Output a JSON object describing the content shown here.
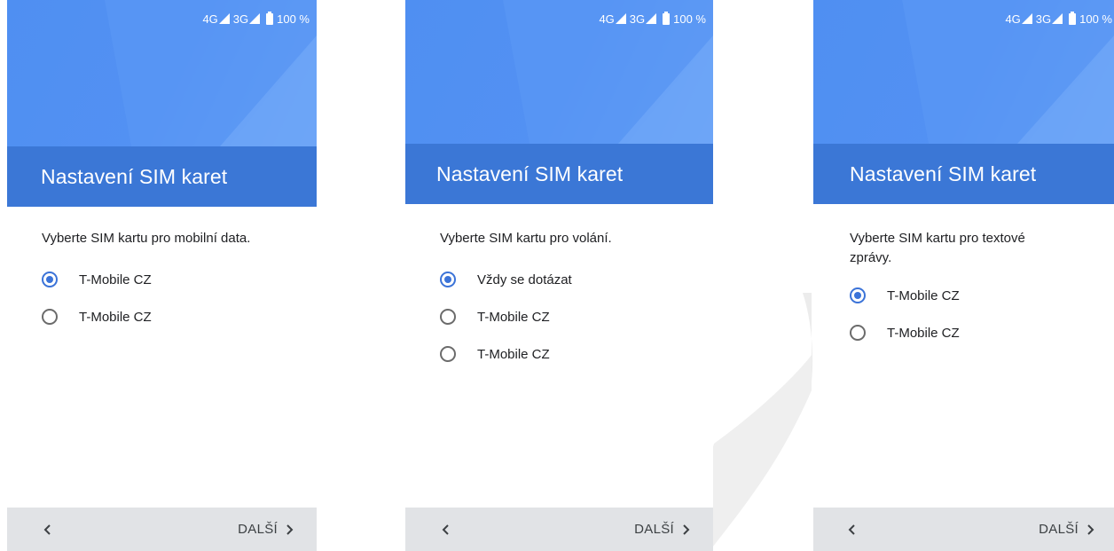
{
  "screens": [
    {
      "status": {
        "net1": "4G",
        "net2": "3G",
        "battery": "100 %"
      },
      "title": "Nastavení SIM karet",
      "prompt": "Vyberte SIM kartu pro mobilní data.",
      "options": [
        {
          "label": "T-Mobile CZ",
          "selected": true
        },
        {
          "label": "T-Mobile CZ",
          "selected": false
        }
      ],
      "next_label": "DALŠÍ"
    },
    {
      "status": {
        "net1": "4G",
        "net2": "3G",
        "battery": "100 %"
      },
      "title": "Nastavení SIM karet",
      "prompt": "Vyberte SIM kartu pro volání.",
      "options": [
        {
          "label": "Vždy se dotázat",
          "selected": true
        },
        {
          "label": "T-Mobile CZ",
          "selected": false
        },
        {
          "label": "T-Mobile CZ",
          "selected": false
        }
      ],
      "next_label": "DALŠÍ"
    },
    {
      "status": {
        "net1": "4G",
        "net2": "3G",
        "battery": "100 %"
      },
      "title": "Nastavení SIM karet",
      "prompt": "Vyberte SIM kartu pro textové zprávy.",
      "options": [
        {
          "label": "T-Mobile CZ",
          "selected": true
        },
        {
          "label": "T-Mobile CZ",
          "selected": false
        }
      ],
      "next_label": "DALŠÍ"
    }
  ],
  "colors": {
    "hero": "#5391f3",
    "title_band": "#3b77d6",
    "radio_accent": "#3b73d8",
    "bottom_bar": "#e1e3e6"
  },
  "icons": {
    "signal": "signal-icon",
    "battery": "battery-icon",
    "back": "chevron-left-icon",
    "next": "chevron-right-icon"
  }
}
